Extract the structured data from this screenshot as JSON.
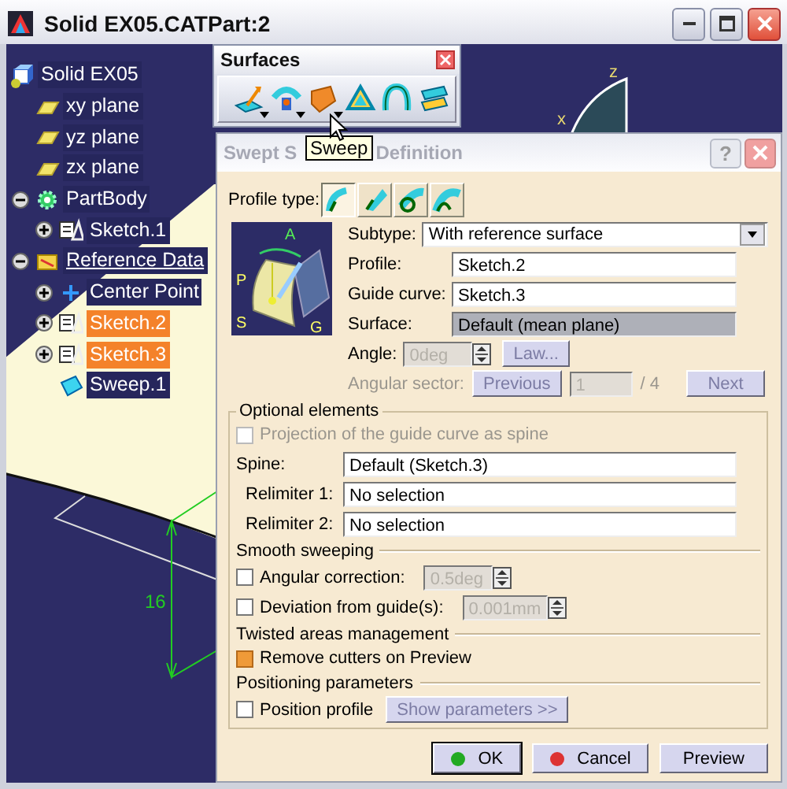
{
  "window": {
    "title": "Solid EX05.CATPart:2",
    "controls": [
      {
        "kind": "minimize"
      },
      {
        "kind": "maximize"
      },
      {
        "kind": "close"
      }
    ]
  },
  "tree": [
    {
      "label": "Solid EX05",
      "kind": "part",
      "selected": false,
      "children": [
        {
          "label": "xy plane",
          "kind": "plane",
          "selected": false,
          "in_work": false
        },
        {
          "label": "yz plane",
          "kind": "plane",
          "selected": false,
          "in_work": false
        },
        {
          "label": "zx plane",
          "kind": "plane",
          "selected": false,
          "in_work": false
        },
        {
          "label": "PartBody",
          "kind": "body",
          "selected": false,
          "in_work": false,
          "expanded": true,
          "children": [
            {
              "label": "Sketch.1",
              "kind": "sketch",
              "selected": false,
              "expanded": false
            }
          ]
        },
        {
          "label": "Reference Data",
          "kind": "geoset",
          "selected": false,
          "in_work": true,
          "expanded": true,
          "children": [
            {
              "label": "Center Point",
              "kind": "point",
              "selected": false,
              "expanded": false
            },
            {
              "label": "Sketch.2",
              "kind": "sketch",
              "selected": true,
              "expanded": false
            },
            {
              "label": "Sketch.3",
              "kind": "sketch",
              "selected": true,
              "expanded": false
            },
            {
              "label": "Sweep.1",
              "kind": "surface",
              "selected": false
            }
          ]
        }
      ]
    }
  ],
  "toolbar": {
    "title": "Surfaces",
    "tools": [
      {
        "kind": "extrude",
        "dropdown": true
      },
      {
        "kind": "revolve",
        "dropdown": true
      },
      {
        "kind": "sweep",
        "dropdown": true
      },
      {
        "kind": "fill",
        "dropdown": false
      },
      {
        "kind": "loft",
        "dropdown": false
      },
      {
        "kind": "blend",
        "dropdown": false
      }
    ]
  },
  "tooltip": "Sweep",
  "viewport": {
    "axis_labels": [
      "z",
      "x"
    ],
    "dimension": "16"
  },
  "dialog": {
    "title_parts": [
      "Swept S",
      "Definition"
    ],
    "help": "?",
    "profile_type": {
      "label": "Profile type:",
      "options": [
        {
          "kind": "explicit",
          "selected": true
        },
        {
          "kind": "line",
          "selected": false
        },
        {
          "kind": "circle",
          "selected": false
        },
        {
          "kind": "conic",
          "selected": false
        }
      ]
    },
    "diagram_labels": [
      "A",
      "P",
      "S",
      "G"
    ],
    "subtype": {
      "label": "Subtype:",
      "value": "With reference surface"
    },
    "profile": {
      "label": "Profile:",
      "value": "Sketch.2"
    },
    "guide_curve": {
      "label": "Guide curve:",
      "value": "Sketch.3"
    },
    "surface": {
      "label": "Surface:",
      "value": "Default (mean plane)",
      "disabled": true
    },
    "angle": {
      "label": "Angle:",
      "value": "0deg",
      "disabled": true
    },
    "law_button": {
      "label": "Law...",
      "disabled": true
    },
    "angular_sector": {
      "label": "Angular sector:",
      "previous": "Previous",
      "value": "1",
      "total": "/ 4",
      "next": "Next",
      "disabled": true
    },
    "optional": {
      "title": "Optional elements",
      "projection": {
        "label": "Projection of the guide curve as spine",
        "checked": false,
        "disabled": true
      },
      "spine": {
        "label": "Spine:",
        "value": "Default (Sketch.3)"
      },
      "relimiters": [
        {
          "label": "Relimiter 1:",
          "value": "No selection"
        },
        {
          "label": "Relimiter 2:",
          "value": "No selection"
        }
      ],
      "sections": [
        {
          "title": "Smooth sweeping",
          "rows": [
            {
              "kind": "check_spin",
              "label": "Angular correction:",
              "checked": false,
              "value": "0.5deg"
            },
            {
              "kind": "check_spin",
              "label": "Deviation from guide(s):",
              "checked": false,
              "value": "0.001mm"
            }
          ]
        },
        {
          "title": "Twisted areas management",
          "rows": [
            {
              "kind": "check",
              "label": "Remove cutters on Preview",
              "checked": true
            }
          ]
        },
        {
          "title": "Positioning parameters",
          "rows": [
            {
              "kind": "check_button",
              "label": "Position profile",
              "checked": false,
              "button": "Show parameters >>"
            }
          ]
        }
      ]
    },
    "buttons": [
      {
        "kind": "ok",
        "label": "OK",
        "default": true
      },
      {
        "kind": "cancel",
        "label": "Cancel",
        "default": false
      },
      {
        "kind": "preview",
        "label": "Preview",
        "default": false
      }
    ]
  }
}
